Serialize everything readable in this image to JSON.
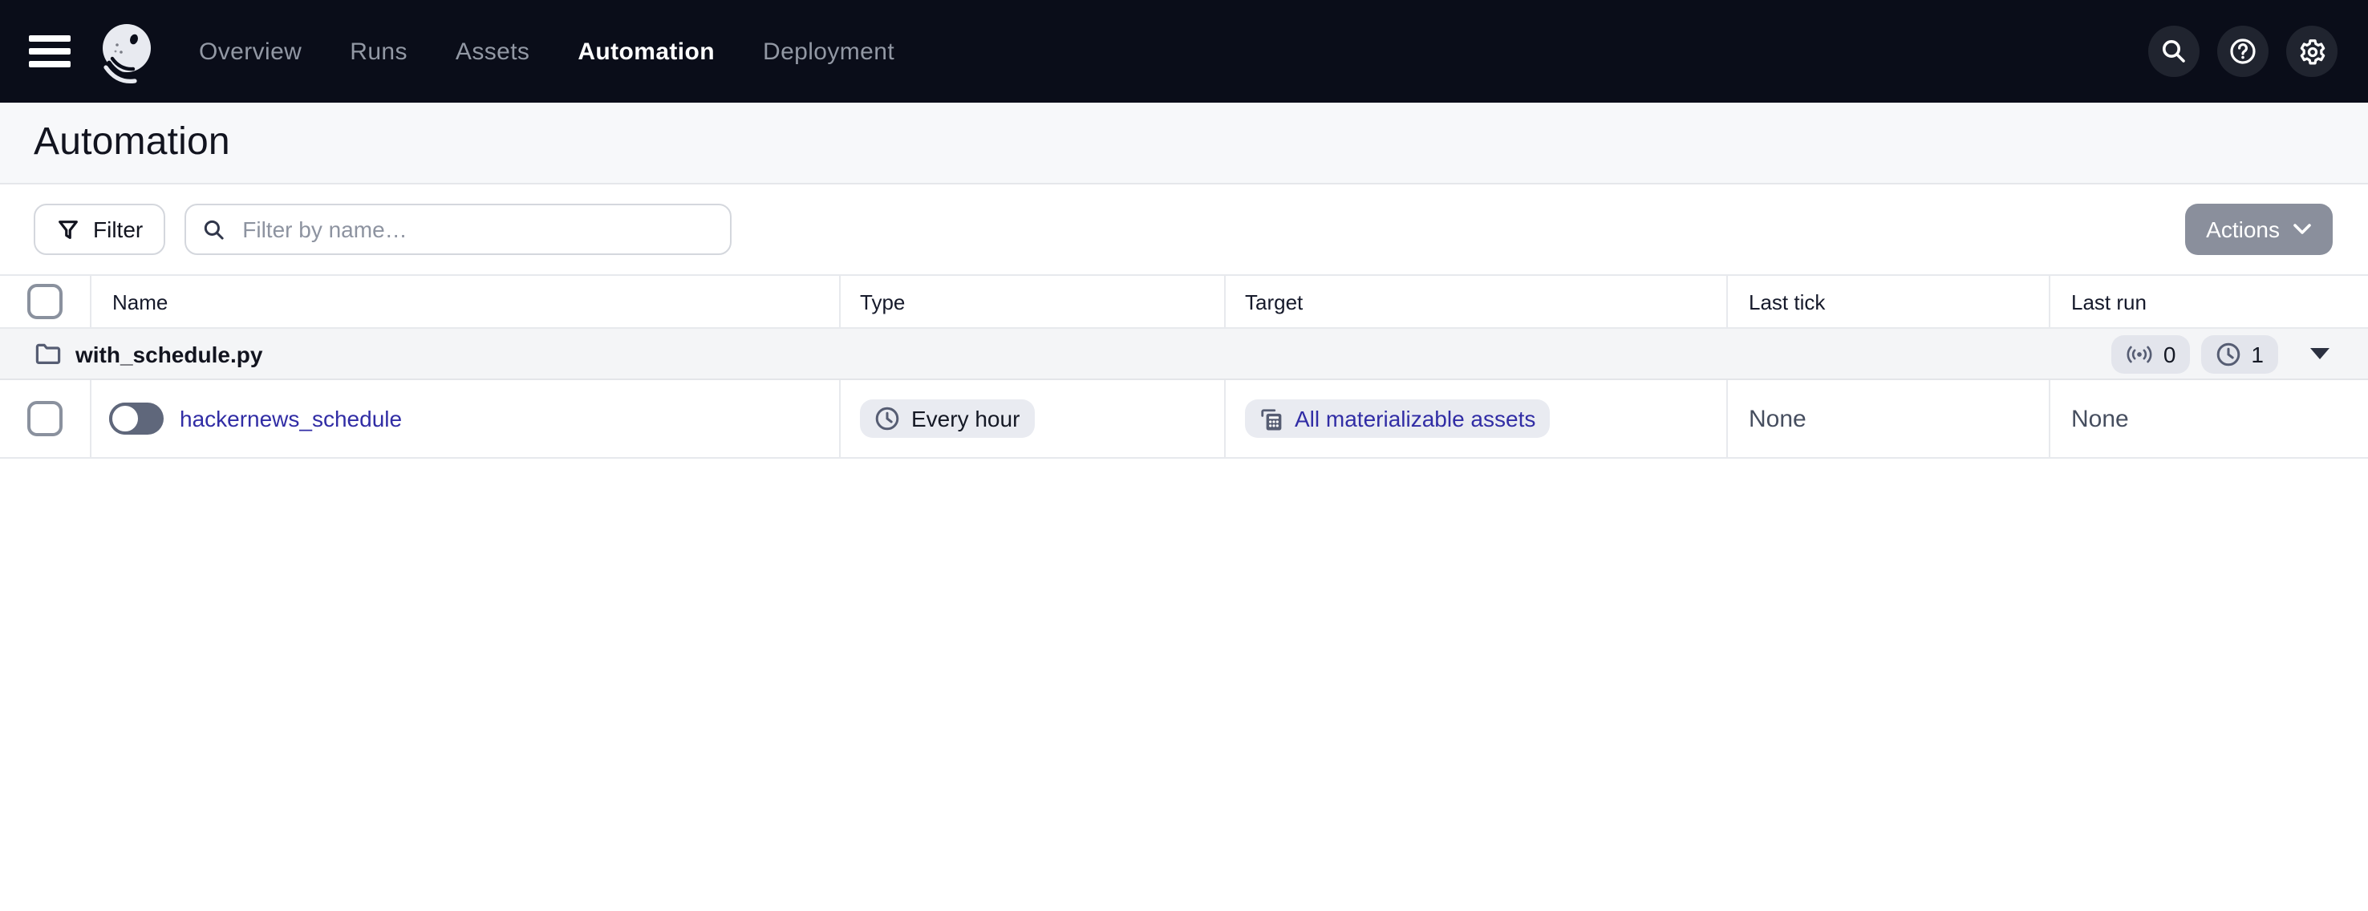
{
  "colors": {
    "topbar_bg": "#0a0d19",
    "icon_circle_bg": "#20242f",
    "accent_link": "#312da5",
    "actions_bg": "#8a8f9c",
    "badge_bg": "#e9ebf1",
    "group_row_bg": "#f4f5f7",
    "border": "#e7e9ed",
    "text_dark": "#12141f",
    "text_muted": "#8d93a0",
    "toggle_track": "#5f677b"
  },
  "topbar": {
    "nav": {
      "items": [
        {
          "label": "Overview",
          "active": false
        },
        {
          "label": "Runs",
          "active": false
        },
        {
          "label": "Assets",
          "active": false
        },
        {
          "label": "Automation",
          "active": true
        },
        {
          "label": "Deployment",
          "active": false
        }
      ]
    },
    "icons": [
      "menu-icon",
      "dagster-logo",
      "search-icon",
      "help-icon",
      "gear-icon"
    ]
  },
  "page": {
    "title": "Automation"
  },
  "toolbar": {
    "filter_label": "Filter",
    "search_placeholder": "Filter by name…",
    "search_value": "",
    "actions_label": "Actions"
  },
  "table": {
    "columns": [
      {
        "label": "Name"
      },
      {
        "label": "Type"
      },
      {
        "label": "Target"
      },
      {
        "label": "Last tick"
      },
      {
        "label": "Last run"
      }
    ],
    "group_row": {
      "name": "with_schedule.py",
      "sensor_count": "0",
      "schedule_count": "1"
    },
    "rows": [
      {
        "name": "hackernews_schedule",
        "toggle_state": "off",
        "type": "Every hour",
        "target": "All materializable assets",
        "last_tick": "None",
        "last_run": "None"
      }
    ]
  }
}
